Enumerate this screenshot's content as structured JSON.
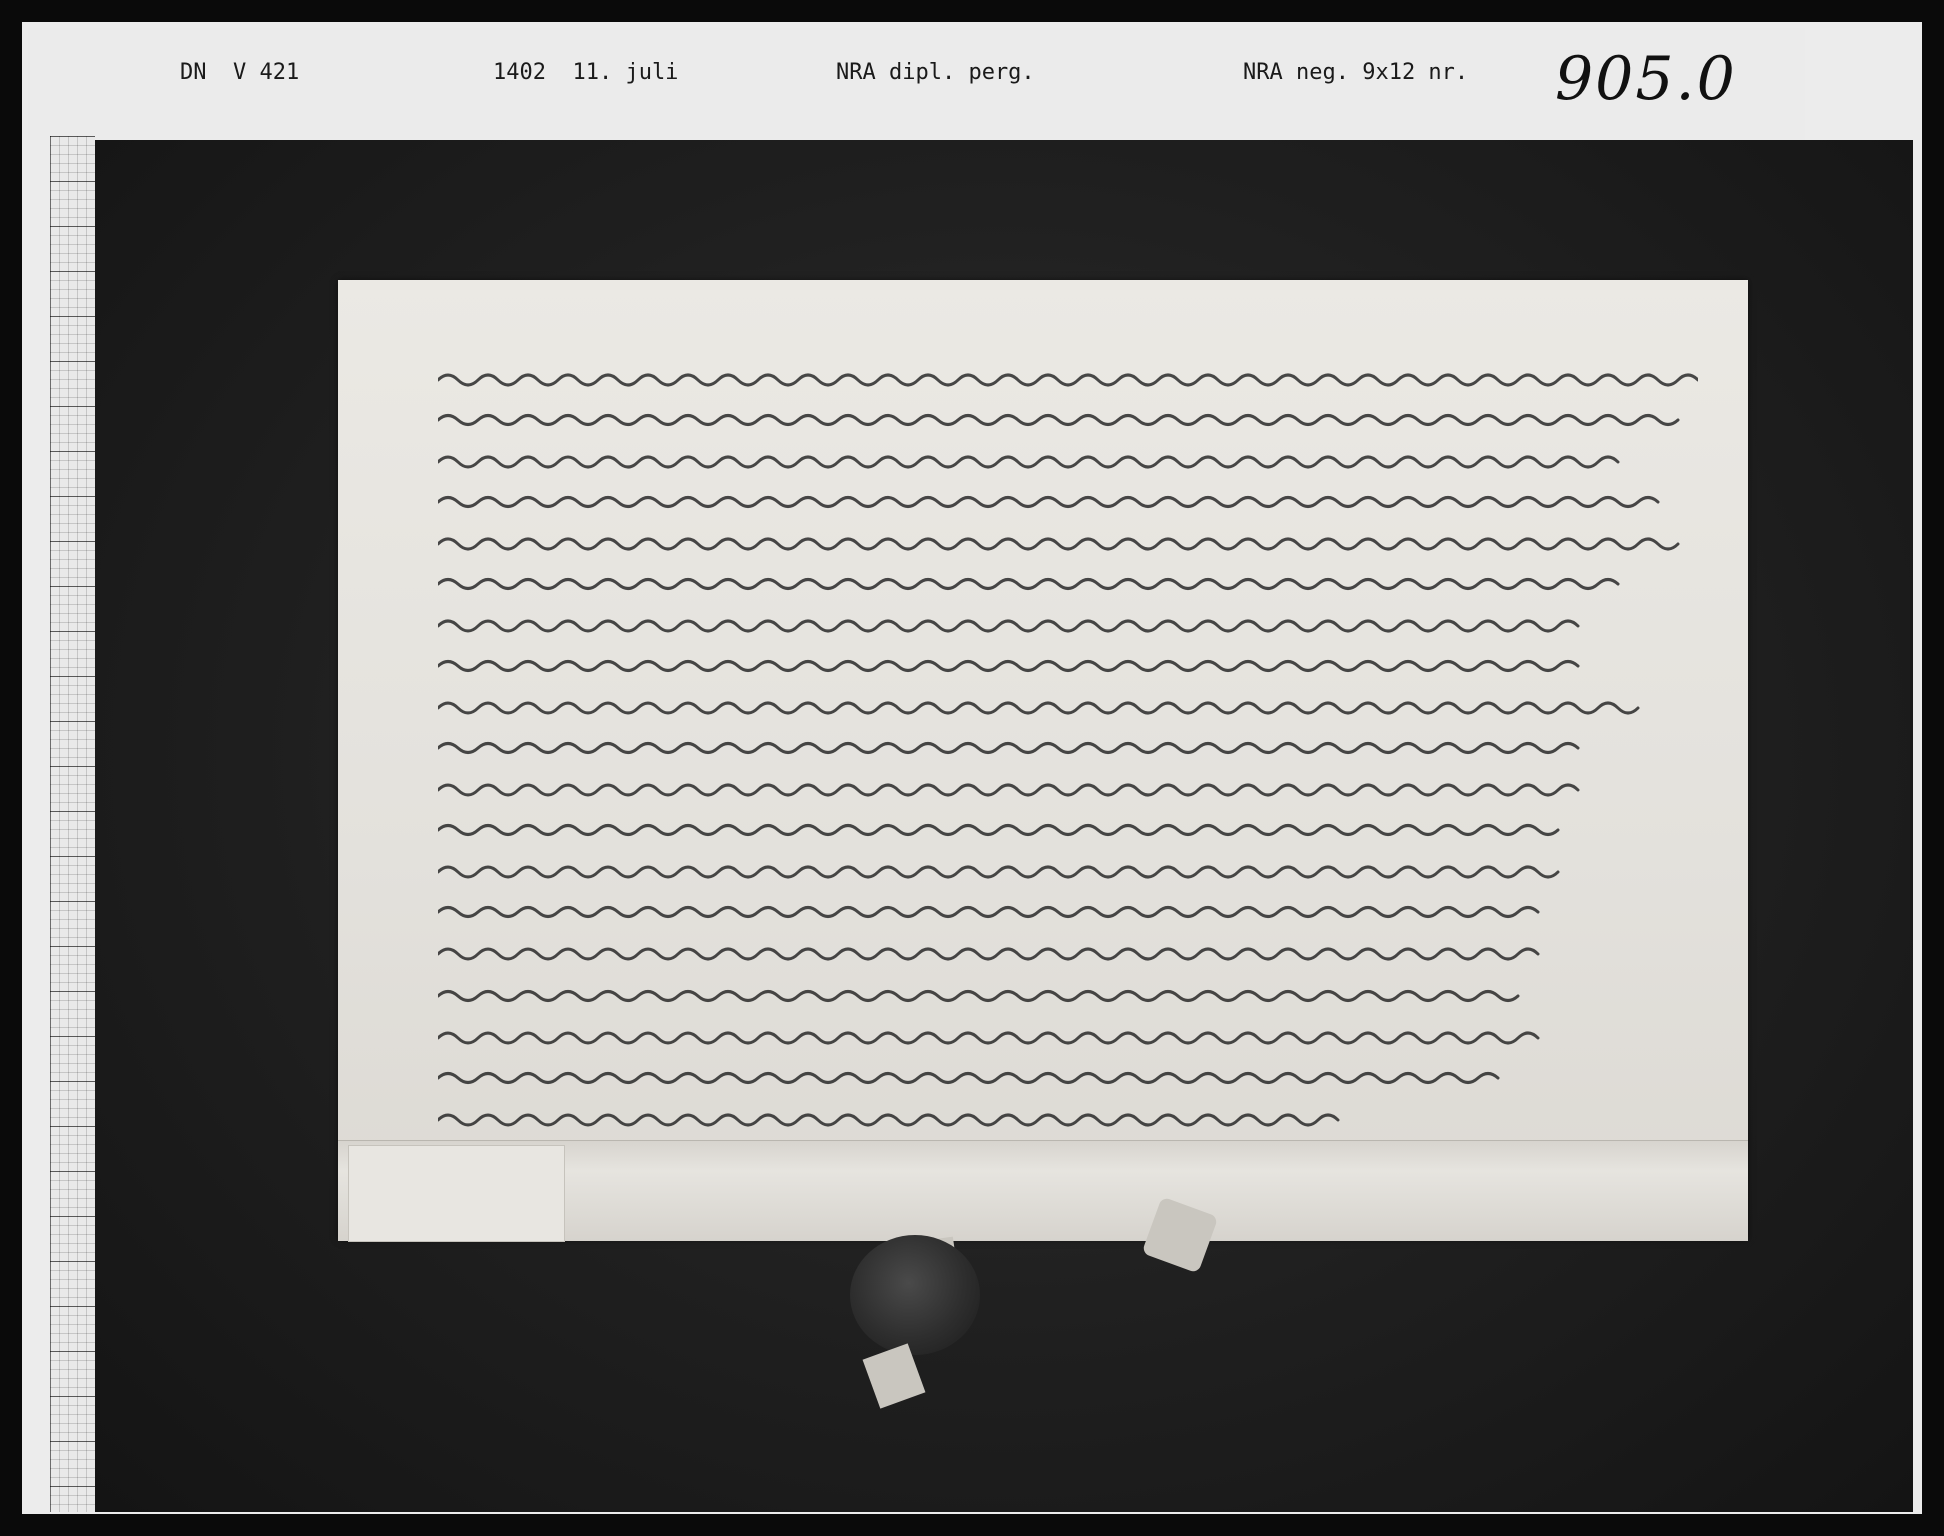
{
  "header": {
    "doc_ref": "DN  V 421",
    "date": "1402  11. juli",
    "archive": "NRA dipl. perg.",
    "negative": "NRA neg. 9x12 nr.",
    "number": "905.0"
  },
  "colors": {
    "background": "#0a0a0a",
    "strip": "#ebebeb",
    "parchment": "#e6e4df",
    "ink": "#2a2a2a",
    "seal": "#2e2e2e"
  }
}
